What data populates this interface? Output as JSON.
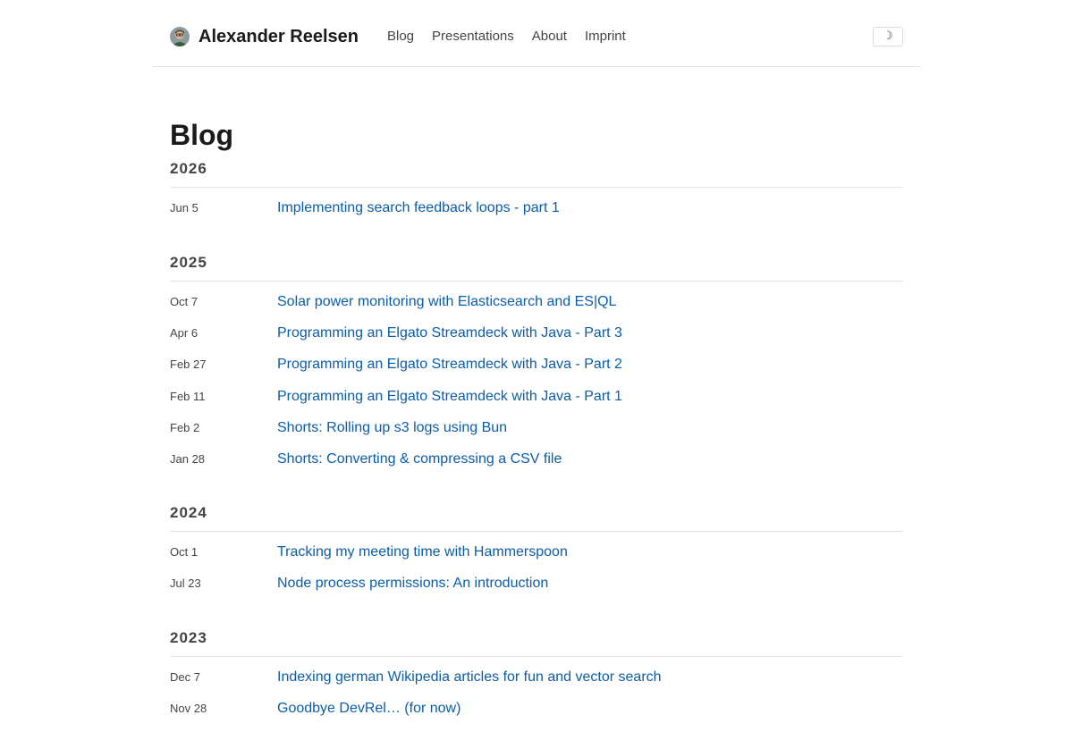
{
  "header": {
    "site_title": "Alexander Reelsen",
    "nav": [
      "Blog",
      "Presentations",
      "About",
      "Imprint"
    ],
    "theme_toggle_glyph": "☽"
  },
  "main": {
    "page_title": "Blog",
    "years": [
      {
        "year": "2026",
        "posts": [
          {
            "date": "Jun 5",
            "title": "Implementing search feedback loops - part 1"
          }
        ]
      },
      {
        "year": "2025",
        "posts": [
          {
            "date": "Oct 7",
            "title": "Solar power monitoring with Elasticsearch and ES|QL"
          },
          {
            "date": "Apr 6",
            "title": "Programming an Elgato Streamdeck with Java - Part 3"
          },
          {
            "date": "Feb 27",
            "title": "Programming an Elgato Streamdeck with Java - Part 2"
          },
          {
            "date": "Feb 11",
            "title": "Programming an Elgato Streamdeck with Java - Part 1"
          },
          {
            "date": "Feb 2",
            "title": "Shorts: Rolling up s3 logs using Bun"
          },
          {
            "date": "Jan 28",
            "title": "Shorts: Converting & compressing a CSV file"
          }
        ]
      },
      {
        "year": "2024",
        "posts": [
          {
            "date": "Oct 1",
            "title": "Tracking my meeting time with Hammerspoon"
          },
          {
            "date": "Jul 23",
            "title": "Node process permissions: An introduction"
          }
        ]
      },
      {
        "year": "2023",
        "posts": [
          {
            "date": "Dec 7",
            "title": "Indexing german Wikipedia articles for fun and vector search"
          },
          {
            "date": "Nov 28",
            "title": "Goodbye DevRel… (for now)"
          }
        ]
      }
    ]
  },
  "colors": {
    "link": "#0b5cad",
    "text": "#1a1a1a",
    "muted": "#444444",
    "divider": "#e3e3e3"
  }
}
